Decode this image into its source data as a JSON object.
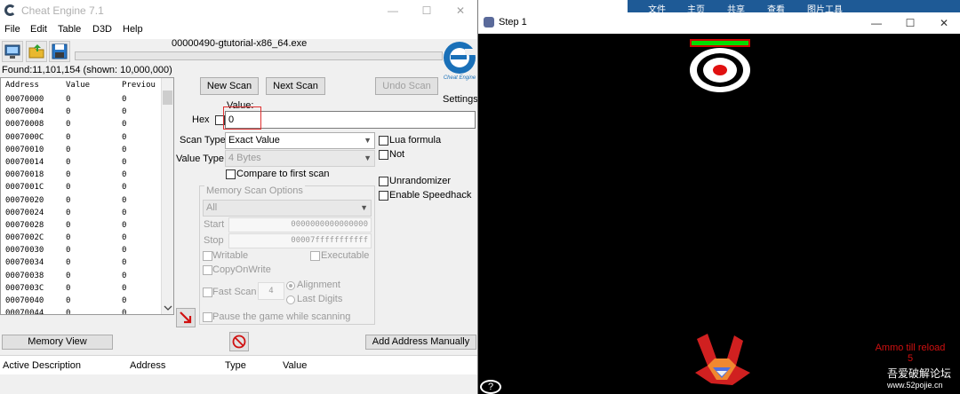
{
  "ce": {
    "title": "Cheat Engine 7.1",
    "window_controls": {
      "minimize": "—",
      "maximize": "☐",
      "close": "✕"
    },
    "menu": [
      "File",
      "Edit",
      "Table",
      "D3D",
      "Help"
    ],
    "process_title": "00000490-gtutorial-x86_64.exe",
    "found_text": "Found:11,101,154 (shown: 10,000,000)",
    "address_list": {
      "headers": [
        "Address",
        "Value",
        "Previou"
      ],
      "rows": [
        [
          "00070000",
          "0",
          "0"
        ],
        [
          "00070004",
          "0",
          "0"
        ],
        [
          "00070008",
          "0",
          "0"
        ],
        [
          "0007000C",
          "0",
          "0"
        ],
        [
          "00070010",
          "0",
          "0"
        ],
        [
          "00070014",
          "0",
          "0"
        ],
        [
          "00070018",
          "0",
          "0"
        ],
        [
          "0007001C",
          "0",
          "0"
        ],
        [
          "00070020",
          "0",
          "0"
        ],
        [
          "00070024",
          "0",
          "0"
        ],
        [
          "00070028",
          "0",
          "0"
        ],
        [
          "0007002C",
          "0",
          "0"
        ],
        [
          "00070030",
          "0",
          "0"
        ],
        [
          "00070034",
          "0",
          "0"
        ],
        [
          "00070038",
          "0",
          "0"
        ],
        [
          "0007003C",
          "0",
          "0"
        ],
        [
          "00070040",
          "0",
          "0"
        ],
        [
          "00070044",
          "0",
          "0"
        ]
      ]
    },
    "buttons": {
      "new_scan": "New Scan",
      "next_scan": "Next Scan",
      "undo_scan": "Undo Scan",
      "memory_view": "Memory View",
      "add_address": "Add Address Manually"
    },
    "settings_label": "Settings",
    "logo_text": "Cheat Engine",
    "value_label": "Value:",
    "hex_label": "Hex",
    "value_input": "0",
    "scan_type_label": "Scan Type",
    "scan_type_value": "Exact Value",
    "value_type_label": "Value Type",
    "value_type_value": "4 Bytes",
    "compare_first": "Compare to first scan",
    "lua_formula": "Lua formula",
    "not_label": "Not",
    "unrandomizer": "Unrandomizer",
    "speedhack": "Enable Speedhack",
    "memory_options": {
      "title": "Memory Scan Options",
      "region": "All",
      "start_label": "Start",
      "start_value": "0000000000000000",
      "stop_label": "Stop",
      "stop_value": "00007fffffffffff",
      "writable": "Writable",
      "executable": "Executable",
      "copy_on_write": "CopyOnWrite",
      "fast_scan": "Fast Scan",
      "fast_scan_value": "4",
      "alignment": "Alignment",
      "last_digits": "Last Digits",
      "pause_game": "Pause the game while scanning"
    },
    "results_headers": [
      "Active Description",
      "Address",
      "Type",
      "Value"
    ]
  },
  "game": {
    "title": "Step 1",
    "ribbon_tabs": [
      "文件",
      "主页",
      "共享",
      "查看",
      "图片工具"
    ],
    "window_controls": {
      "minimize": "—",
      "maximize": "☐",
      "close": "✕"
    },
    "ammo_label": "Ammo till reload",
    "ammo_count": "5",
    "watermark": "吾爱破解论坛",
    "watermark_url": "www.52pojie.cn",
    "help": "?"
  },
  "colors": {
    "health_bar": "#00dd00",
    "health_border": "#d00000",
    "ammo_text": "#d01010",
    "target_red": "#e01010"
  }
}
